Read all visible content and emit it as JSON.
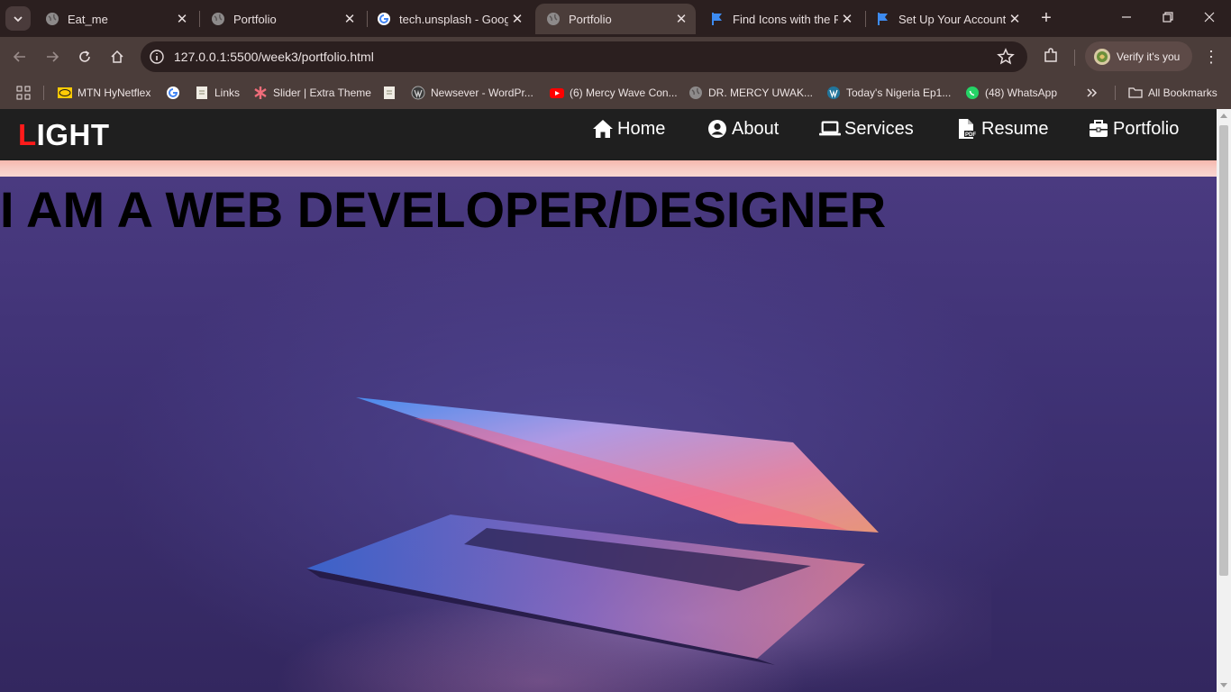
{
  "browser": {
    "tabs": [
      {
        "title": "Eat_me",
        "icon": "globe-icon",
        "active": false
      },
      {
        "title": "Portfolio",
        "icon": "globe-icon",
        "active": false
      },
      {
        "title": "tech.unsplash - Google",
        "icon": "google-icon",
        "active": false
      },
      {
        "title": "Portfolio",
        "icon": "globe-icon",
        "active": true
      },
      {
        "title": "Find Icons with the Perfect",
        "icon": "flag-icon",
        "active": false
      },
      {
        "title": "Set Up Your Account",
        "icon": "flag-icon",
        "active": false
      }
    ],
    "address_bar": {
      "url": "127.0.0.1:5500/week3/portfolio.html"
    },
    "profile_button": {
      "label": "Verify it's you"
    },
    "bookmarks": [
      {
        "label": "MTN HyNetflex",
        "icon": "mtn-icon"
      },
      {
        "label": "",
        "icon": "google-icon"
      },
      {
        "label": "Links",
        "icon": "page-icon"
      },
      {
        "label": "Slider | Extra Theme",
        "icon": "asterisk-icon"
      },
      {
        "label": "",
        "icon": "page-icon"
      },
      {
        "label": "Newsever - WordPr...",
        "icon": "wordpress-icon"
      },
      {
        "label": "(6) Mercy Wave Con...",
        "icon": "youtube-icon"
      },
      {
        "label": "DR. MERCY UWAK...",
        "icon": "globe-icon"
      },
      {
        "label": "Today's Nigeria Ep1...",
        "icon": "wordpress-icon"
      },
      {
        "label": "(48) WhatsApp",
        "icon": "whatsapp-icon"
      }
    ],
    "all_bookmarks_label": "All Bookmarks",
    "colors": {
      "chrome_dark": "#2b1f1f",
      "chrome": "#4b3d3a"
    }
  },
  "site": {
    "logo": {
      "first_letter": "L",
      "rest": "IGHT"
    },
    "nav": [
      {
        "label": "Home",
        "icon": "home-icon"
      },
      {
        "label": "About",
        "icon": "user-circle-icon"
      },
      {
        "label": "Services",
        "icon": "laptop-icon"
      },
      {
        "label": "Resume",
        "icon": "file-pdf-icon"
      },
      {
        "label": "Portfolio",
        "icon": "briefcase-icon"
      }
    ],
    "hero_title": "I AM A WEB DEVELOPER/DESIGNER",
    "colors": {
      "logo_accent": "#ff1b1b",
      "nav_bg": "#1f1f1f",
      "hero_bg": "#35285f"
    }
  }
}
